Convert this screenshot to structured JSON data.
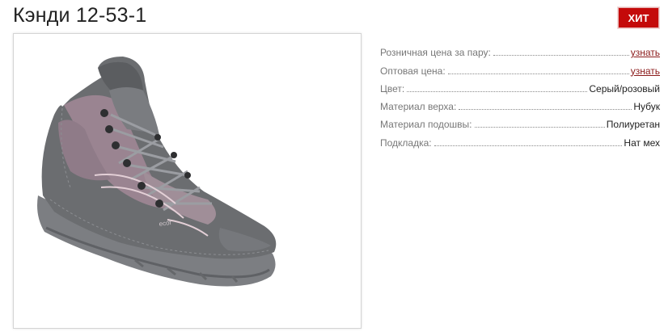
{
  "product": {
    "title": "Кэнди 12-53-1",
    "badge": "ХИТ",
    "image_alt": "Серый ботинок с розовыми вставками и шнуровкой"
  },
  "specs": [
    {
      "label": "Розничная цена за пару:",
      "value": "узнать",
      "link": true
    },
    {
      "label": "Оптовая цена:",
      "value": "узнать",
      "link": true
    },
    {
      "label": "Цвет:",
      "value": "Серый/розовый",
      "link": false
    },
    {
      "label": "Материал верха:",
      "value": "Нубук",
      "link": false
    },
    {
      "label": "Материал подошвы:",
      "value": "Полиуретан",
      "link": false
    },
    {
      "label": "Подкладка:",
      "value": "Нат мех",
      "link": false
    }
  ],
  "colors": {
    "badge_bg": "#c40a0a",
    "link": "#8b1a1a",
    "label": "#777777",
    "title": "#222222"
  }
}
